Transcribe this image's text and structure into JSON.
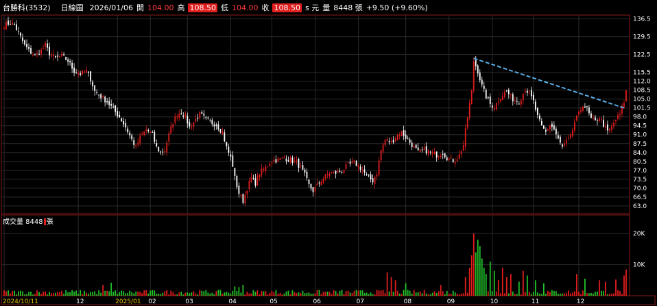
{
  "header": {
    "symbol": "台勝科(3532)",
    "period": "日線圖",
    "date": "2026/01/06",
    "open_label": "開",
    "open": "104.00",
    "high_label": "高",
    "high": "108.50",
    "low_label": "低",
    "low": "104.00",
    "close_label": "收",
    "close": "108.50",
    "unit": "s 元",
    "volume_label": "量",
    "volume": "8448 張",
    "change": "+9.50 (+9.60%)"
  },
  "volume_panel": {
    "label": "成交量 8448",
    "unit": "張"
  },
  "colors": {
    "up": "#e11d1d",
    "down": "#ffffff",
    "vol_up": "#e11d1d",
    "vol_down": "#22c22a",
    "trend": "#5aaee8",
    "grid": "#2a2a2a",
    "border": "#8b1a1a",
    "year_label": "#e8c200"
  },
  "chart_data": [
    {
      "type": "candlestick",
      "ylim": [
        60,
        138
      ],
      "y_ticks": [
        136.5,
        129.5,
        122.5,
        115.5,
        112.0,
        108.5,
        105.0,
        101.5,
        98.0,
        94.5,
        91.0,
        87.5,
        84.0,
        80.5,
        77.0,
        73.5,
        70.0,
        66.5,
        63.0
      ],
      "x_ticks": [
        {
          "label": "2024/10/11",
          "i": 0,
          "year": true
        },
        {
          "label": "12",
          "i": 36
        },
        {
          "label": "2025/01",
          "i": 55,
          "year": true
        },
        {
          "label": "02",
          "i": 71
        },
        {
          "label": "03",
          "i": 89
        },
        {
          "label": "04",
          "i": 110
        },
        {
          "label": "05",
          "i": 130
        },
        {
          "label": "06",
          "i": 151
        },
        {
          "label": "07",
          "i": 172
        },
        {
          "label": "08",
          "i": 195
        },
        {
          "label": "09",
          "i": 216
        },
        {
          "label": "10",
          "i": 237
        },
        {
          "label": "11",
          "i": 257
        },
        {
          "label": "12",
          "i": 279
        }
      ],
      "trendline": {
        "from": {
          "i": 228,
          "value": 121.0
        },
        "to": {
          "i": 301,
          "value": 101.5
        }
      },
      "path": [
        [
          0,
          134
        ],
        [
          3,
          135
        ],
        [
          5,
          134
        ],
        [
          7,
          131
        ],
        [
          10,
          126
        ],
        [
          12,
          124
        ],
        [
          15,
          122
        ],
        [
          18,
          124
        ],
        [
          20,
          126
        ],
        [
          22,
          123
        ],
        [
          25,
          121
        ],
        [
          28,
          122
        ],
        [
          31,
          120
        ],
        [
          34,
          116
        ],
        [
          37,
          115
        ],
        [
          40,
          116
        ],
        [
          42,
          113
        ],
        [
          44,
          108
        ],
        [
          47,
          106
        ],
        [
          50,
          104
        ],
        [
          53,
          101
        ],
        [
          56,
          98
        ],
        [
          59,
          94
        ],
        [
          62,
          89
        ],
        [
          64,
          86
        ],
        [
          66,
          90
        ],
        [
          69,
          93
        ],
        [
          72,
          91
        ],
        [
          74,
          86
        ],
        [
          76,
          84
        ],
        [
          78,
          85
        ],
        [
          80,
          91
        ],
        [
          82,
          96
        ],
        [
          84,
          99
        ],
        [
          86,
          100
        ],
        [
          88,
          98
        ],
        [
          90,
          94
        ],
        [
          92,
          96
        ],
        [
          95,
          99
        ],
        [
          98,
          97
        ],
        [
          100,
          96
        ],
        [
          103,
          95
        ],
        [
          106,
          92
        ],
        [
          108,
          86
        ],
        [
          110,
          82
        ],
        [
          111,
          79
        ],
        [
          112,
          74
        ],
        [
          114,
          68
        ],
        [
          116,
          65
        ],
        [
          118,
          70
        ],
        [
          120,
          74
        ],
        [
          122,
          72
        ],
        [
          124,
          76
        ],
        [
          127,
          78
        ],
        [
          130,
          81
        ],
        [
          133,
          81
        ],
        [
          136,
          82
        ],
        [
          139,
          81
        ],
        [
          142,
          80
        ],
        [
          144,
          78
        ],
        [
          146,
          75
        ],
        [
          148,
          71
        ],
        [
          150,
          69
        ],
        [
          152,
          71
        ],
        [
          155,
          74
        ],
        [
          158,
          76
        ],
        [
          161,
          76
        ],
        [
          164,
          77
        ],
        [
          167,
          79
        ],
        [
          170,
          80
        ],
        [
          173,
          78
        ],
        [
          175,
          76
        ],
        [
          177,
          74
        ],
        [
          179,
          73
        ],
        [
          181,
          76
        ],
        [
          183,
          85
        ],
        [
          185,
          89
        ],
        [
          188,
          88
        ],
        [
          191,
          91
        ],
        [
          193,
          92
        ],
        [
          195,
          90
        ],
        [
          198,
          87
        ],
        [
          201,
          84
        ],
        [
          204,
          85
        ],
        [
          207,
          84
        ],
        [
          210,
          83
        ],
        [
          213,
          84
        ],
        [
          215,
          82
        ],
        [
          217,
          81
        ],
        [
          219,
          81
        ],
        [
          221,
          83
        ],
        [
          223,
          87
        ],
        [
          225,
          98
        ],
        [
          227,
          108
        ],
        [
          228,
          120
        ],
        [
          230,
          116
        ],
        [
          232,
          110
        ],
        [
          234,
          106
        ],
        [
          236,
          103
        ],
        [
          238,
          102
        ],
        [
          241,
          106
        ],
        [
          244,
          108
        ],
        [
          247,
          105
        ],
        [
          250,
          104
        ],
        [
          253,
          109
        ],
        [
          255,
          107
        ],
        [
          257,
          104
        ],
        [
          259,
          98
        ],
        [
          261,
          94
        ],
        [
          263,
          92
        ],
        [
          265,
          95
        ],
        [
          267,
          93
        ],
        [
          269,
          89
        ],
        [
          271,
          86
        ],
        [
          273,
          88
        ],
        [
          275,
          90
        ],
        [
          277,
          96
        ],
        [
          279,
          99
        ],
        [
          281,
          103
        ],
        [
          283,
          101
        ],
        [
          285,
          97
        ],
        [
          287,
          96
        ],
        [
          289,
          98
        ],
        [
          291,
          95
        ],
        [
          293,
          92
        ],
        [
          295,
          94
        ],
        [
          297,
          97
        ],
        [
          299,
          99
        ],
        [
          301,
          104
        ],
        [
          302,
          108.5
        ]
      ]
    },
    {
      "type": "bar",
      "name": "成交量",
      "ylim": [
        0,
        26000
      ],
      "y_ticks": [
        {
          "label": "20K",
          "value": 20000
        },
        {
          "label": "10K",
          "value": 10000
        }
      ],
      "spikes": [
        [
          48,
          3500
        ],
        [
          52,
          4200
        ],
        [
          112,
          3000
        ],
        [
          114,
          2800
        ],
        [
          116,
          3500
        ],
        [
          186,
          7500
        ],
        [
          188,
          6000
        ],
        [
          190,
          5000
        ],
        [
          195,
          4000
        ],
        [
          212,
          3500
        ],
        [
          224,
          6000
        ],
        [
          226,
          9000
        ],
        [
          227,
          13000
        ],
        [
          228,
          20000
        ],
        [
          229,
          14000
        ],
        [
          230,
          18000
        ],
        [
          231,
          16000
        ],
        [
          232,
          12000
        ],
        [
          233,
          9000
        ],
        [
          234,
          7000
        ],
        [
          236,
          11000
        ],
        [
          238,
          8000
        ],
        [
          240,
          5000
        ],
        [
          242,
          9000
        ],
        [
          244,
          6000
        ],
        [
          246,
          7000
        ],
        [
          250,
          4500
        ],
        [
          252,
          8000
        ],
        [
          254,
          6500
        ],
        [
          258,
          5000
        ],
        [
          262,
          4000
        ],
        [
          278,
          7000
        ],
        [
          282,
          5500
        ],
        [
          289,
          5000
        ],
        [
          292,
          4500
        ],
        [
          297,
          5200
        ],
        [
          301,
          6500
        ],
        [
          302,
          8448
        ]
      ]
    }
  ]
}
